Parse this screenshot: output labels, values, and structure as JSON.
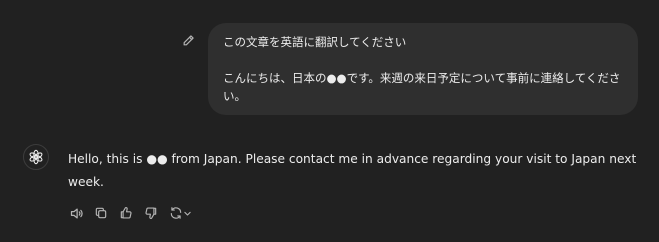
{
  "user_message": {
    "line1": "この文章を英語に翻訳してください",
    "line2": "こんにちは、日本の●●です。来週の来日予定について事前に連絡してくださ",
    "line3": "い。"
  },
  "assistant_message": {
    "text": "Hello, this is ●● from Japan. Please contact me in advance regarding your visit to Japan next week."
  },
  "icons": {
    "edit": "pencil-icon",
    "avatar": "openai-logo-icon",
    "read_aloud": "speaker-icon",
    "copy": "copy-icon",
    "thumbs_up": "thumbs-up-icon",
    "thumbs_down": "thumbs-down-icon",
    "regenerate": "refresh-icon",
    "model_menu": "chevron-down-icon"
  },
  "colors": {
    "background": "#212121",
    "bubble": "#2f2f2f",
    "text": "#ececec",
    "icon": "#b4b4b4"
  }
}
